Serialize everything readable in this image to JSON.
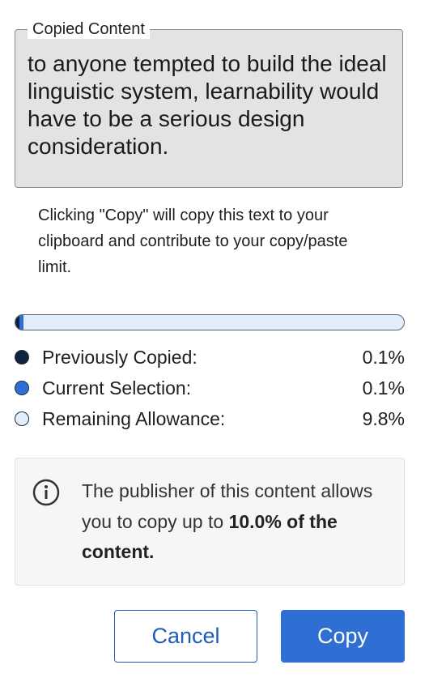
{
  "copied_content": {
    "legend": "Copied Content",
    "text": "to anyone tempted to build the ideal linguistic system, learnability would have to be a serious design consideration."
  },
  "notice": "Clicking \"Copy\" will copy this text to your clipboard and contribute to your copy/paste limit.",
  "usage": {
    "previously_copied_percent": 0.1,
    "current_selection_percent": 0.1,
    "remaining_allowance_percent": 9.8,
    "limit_percent": 10.0
  },
  "legend_items": [
    {
      "label": "Previously Copied:",
      "value": "0.1%",
      "color": "#0d2340"
    },
    {
      "label": "Current Selection:",
      "value": "0.1%",
      "color": "#2f6fd3"
    },
    {
      "label": "Remaining Allowance:",
      "value": "9.8%",
      "color": "#e3eefb"
    }
  ],
  "info": {
    "icon": "info-icon",
    "text_prefix": "The publisher of this content allows you to copy up to ",
    "text_bold": "10.0% of the content."
  },
  "buttons": {
    "cancel": "Cancel",
    "copy": "Copy"
  },
  "colors": {
    "accent": "#2f6fd3",
    "previous": "#0d2340",
    "remaining": "#e3eefb"
  }
}
